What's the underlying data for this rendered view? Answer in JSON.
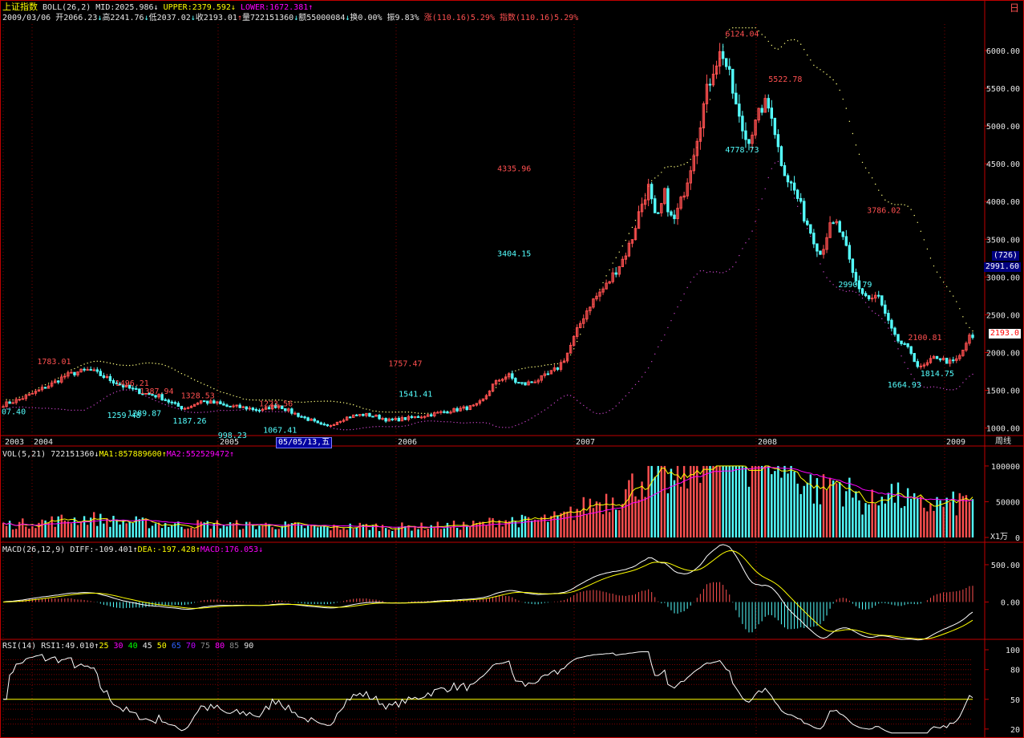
{
  "window": {
    "corner_label": "日"
  },
  "header1": {
    "title": "上证指数",
    "indicator": "BOLL(26,2)",
    "mid": "MID:2025.986",
    "mid_arrow": "↓",
    "upper": "UPPER:2379.592",
    "upper_arrow": "↓",
    "lower": "LOWER:1672.381",
    "lower_arrow": "↑"
  },
  "header2": {
    "date": "2009/03/06",
    "open": "开2066.23",
    "open_arrow": "↓",
    "high": "高2241.76",
    "high_arrow": "↓",
    "low": "低2037.02",
    "low_arrow": "↓",
    "close": "收2193.01",
    "close_arrow": "↑",
    "volume": "量722151360",
    "volume_arrow": "↓",
    "amount": "额55000084",
    "amount_arrow": "↓",
    "turnover": "换0.00%",
    "amplitude": "振9.83%",
    "change": "涨(110.16)5.29%",
    "index_change": "指数(110.16)5.29%"
  },
  "vol_header": {
    "label": "VOL(5,21)",
    "value": "722151360",
    "value_arrow": "↓",
    "ma1": "MA1:857889600",
    "ma1_arrow": "↑",
    "ma2": "MA2:552529472",
    "ma2_arrow": "↑"
  },
  "macd_header": {
    "label": "MACD(26,12,9)",
    "diff": "DIFF:-109.401",
    "diff_arrow": "↑",
    "dea": "DEA:-197.428",
    "dea_arrow": "↑",
    "macd": "MACD:176.053",
    "macd_arrow": "↓"
  },
  "rsi_header": {
    "label": "RSI(14)",
    "rsi1": "RSI1:49.010",
    "rsi1_arrow": "↑",
    "levels": [
      "25",
      "30",
      "40",
      "45",
      "50",
      "65",
      "70",
      "75",
      "80",
      "85",
      "90"
    ]
  },
  "colors": {
    "up": "#ff5050",
    "down": "#54ffff",
    "mid_band": "#ffff80",
    "lower_band": "#c040c0",
    "grid": "#c00000",
    "ma1": "#ffff00",
    "ma2": "#ff00ff",
    "diff": "#ffffff",
    "dea": "#ffff00"
  },
  "tags": {
    "badge_top": "(726)",
    "badge_price": "2991.60",
    "close_price": "2193.0",
    "vol_unit": "X1万",
    "cursor_date": "05/05/13,五",
    "period": "周线"
  },
  "chart_data": [
    {
      "type": "candlestick",
      "name": "price",
      "y_ticks": [
        1000,
        1500,
        2000,
        2500,
        3000,
        3500,
        4000,
        4500,
        5000,
        5500,
        6000
      ],
      "y_tick_labels": [
        "1000.00",
        "1500.00",
        "2000.00",
        "2500.00",
        "3000.00",
        "3500.00",
        "4000.00",
        "4500.00",
        "5000.00",
        "5500.00",
        "6000.00"
      ],
      "ylim": [
        900,
        6350
      ],
      "x_labels": [
        "2003",
        "2004",
        "2005",
        "2006",
        "2007",
        "2008",
        "2009"
      ],
      "annotations": [
        {
          "text": "1783.01",
          "value": 1783,
          "color": "up"
        },
        {
          "text": "1496.21",
          "value": 1496,
          "color": "up"
        },
        {
          "text": "1387.94",
          "value": 1388,
          "color": "up"
        },
        {
          "text": "1328.53",
          "value": 1329,
          "color": "up"
        },
        {
          "text": "1223.56",
          "value": 1224,
          "color": "up"
        },
        {
          "text": "1757.47",
          "value": 1757,
          "color": "up"
        },
        {
          "text": "4335.96",
          "value": 4336,
          "color": "up"
        },
        {
          "text": "6124.04",
          "value": 6124,
          "color": "up"
        },
        {
          "text": "5522.78",
          "value": 5523,
          "color": "up"
        },
        {
          "text": "3786.02",
          "value": 3786,
          "color": "up"
        },
        {
          "text": "2100.81",
          "value": 2101,
          "color": "up"
        },
        {
          "text": "07.40",
          "value": 1307,
          "color": "down"
        },
        {
          "text": "1259.48",
          "value": 1259,
          "color": "down"
        },
        {
          "text": "1289.87",
          "value": 1290,
          "color": "down"
        },
        {
          "text": "1187.26",
          "value": 1187,
          "color": "down"
        },
        {
          "text": "998.23",
          "value": 998,
          "color": "down"
        },
        {
          "text": "1067.41",
          "value": 1067,
          "color": "down"
        },
        {
          "text": "1541.41",
          "value": 1541,
          "color": "down"
        },
        {
          "text": "3404.15",
          "value": 3404,
          "color": "down"
        },
        {
          "text": "4778.73",
          "value": 4779,
          "color": "down"
        },
        {
          "text": "2990.79",
          "value": 2991,
          "color": "down"
        },
        {
          "text": "1664.93",
          "value": 1665,
          "color": "down"
        },
        {
          "text": "1814.75",
          "value": 1815,
          "color": "down"
        }
      ],
      "close_path": [
        [
          0,
          1310
        ],
        [
          8,
          1380
        ],
        [
          16,
          1480
        ],
        [
          24,
          1590
        ],
        [
          30,
          1690
        ],
        [
          36,
          1740
        ],
        [
          42,
          1770
        ],
        [
          46,
          1720
        ],
        [
          52,
          1640
        ],
        [
          58,
          1560
        ],
        [
          64,
          1500
        ],
        [
          70,
          1450
        ],
        [
          76,
          1420
        ],
        [
          80,
          1360
        ],
        [
          84,
          1300
        ],
        [
          88,
          1260
        ],
        [
          92,
          1300
        ],
        [
          96,
          1360
        ],
        [
          100,
          1340
        ],
        [
          104,
          1330
        ],
        [
          108,
          1290
        ],
        [
          114,
          1280
        ],
        [
          120,
          1260
        ],
        [
          126,
          1230
        ],
        [
          130,
          1280
        ],
        [
          134,
          1300
        ],
        [
          138,
          1240
        ],
        [
          142,
          1190
        ],
        [
          146,
          1140
        ],
        [
          150,
          1100
        ],
        [
          154,
          1040
        ],
        [
          158,
          1020
        ],
        [
          162,
          1080
        ],
        [
          166,
          1130
        ],
        [
          170,
          1160
        ],
        [
          176,
          1180
        ],
        [
          182,
          1150
        ],
        [
          188,
          1100
        ],
        [
          194,
          1120
        ],
        [
          200,
          1140
        ],
        [
          206,
          1170
        ],
        [
          212,
          1200
        ],
        [
          218,
          1230
        ],
        [
          224,
          1260
        ],
        [
          230,
          1290
        ],
        [
          234,
          1380
        ],
        [
          238,
          1560
        ],
        [
          242,
          1650
        ],
        [
          246,
          1700
        ],
        [
          250,
          1600
        ],
        [
          254,
          1580
        ],
        [
          258,
          1620
        ],
        [
          262,
          1660
        ],
        [
          266,
          1720
        ],
        [
          270,
          1800
        ],
        [
          274,
          1950
        ],
        [
          278,
          2200
        ],
        [
          282,
          2450
        ],
        [
          286,
          2650
        ],
        [
          290,
          2780
        ],
        [
          294,
          2900
        ],
        [
          298,
          3080
        ],
        [
          302,
          3250
        ],
        [
          306,
          3500
        ],
        [
          310,
          3900
        ],
        [
          314,
          4200
        ],
        [
          318,
          3700
        ],
        [
          322,
          4100
        ],
        [
          326,
          3700
        ],
        [
          330,
          4000
        ],
        [
          334,
          4400
        ],
        [
          338,
          4900
        ],
        [
          342,
          5400
        ],
        [
          346,
          5800
        ],
        [
          350,
          6000
        ],
        [
          354,
          5600
        ],
        [
          358,
          5100
        ],
        [
          362,
          4800
        ],
        [
          366,
          5000
        ],
        [
          370,
          5300
        ],
        [
          374,
          5200
        ],
        [
          378,
          4600
        ],
        [
          382,
          4300
        ],
        [
          386,
          4100
        ],
        [
          390,
          3800
        ],
        [
          394,
          3550
        ],
        [
          398,
          3300
        ],
        [
          402,
          3650
        ],
        [
          406,
          3700
        ],
        [
          410,
          3400
        ],
        [
          414,
          3000
        ],
        [
          418,
          2800
        ],
        [
          422,
          2700
        ],
        [
          426,
          2750
        ],
        [
          430,
          2450
        ],
        [
          434,
          2200
        ],
        [
          438,
          2100
        ],
        [
          442,
          2000
        ],
        [
          446,
          1780
        ],
        [
          450,
          1850
        ],
        [
          454,
          1950
        ],
        [
          458,
          1900
        ],
        [
          462,
          1860
        ],
        [
          466,
          1950
        ],
        [
          470,
          2200
        ],
        [
          472,
          2193
        ]
      ]
    },
    {
      "type": "bar",
      "name": "volume",
      "y_tick_labels": [
        "100000",
        "50000",
        "0"
      ],
      "y_ticks": [
        100000,
        50000,
        0
      ],
      "ylim": [
        0,
        110000
      ],
      "series": [
        {
          "name": "MA1"
        },
        {
          "name": "MA2"
        }
      ]
    },
    {
      "type": "line",
      "name": "macd",
      "y_tick_labels": [
        "500.00",
        "0.00"
      ],
      "y_ticks": [
        500,
        0
      ],
      "ylim": [
        -500,
        650
      ],
      "series": [
        {
          "name": "DIFF"
        },
        {
          "name": "DEA"
        },
        {
          "name": "MACD"
        }
      ]
    },
    {
      "type": "line",
      "name": "rsi",
      "y_tick_labels": [
        "100",
        "80",
        "50",
        "20"
      ],
      "y_ticks": [
        100,
        80,
        50,
        20
      ],
      "ylim": [
        15,
        100
      ],
      "series": [
        {
          "name": "RSI1"
        }
      ]
    }
  ]
}
